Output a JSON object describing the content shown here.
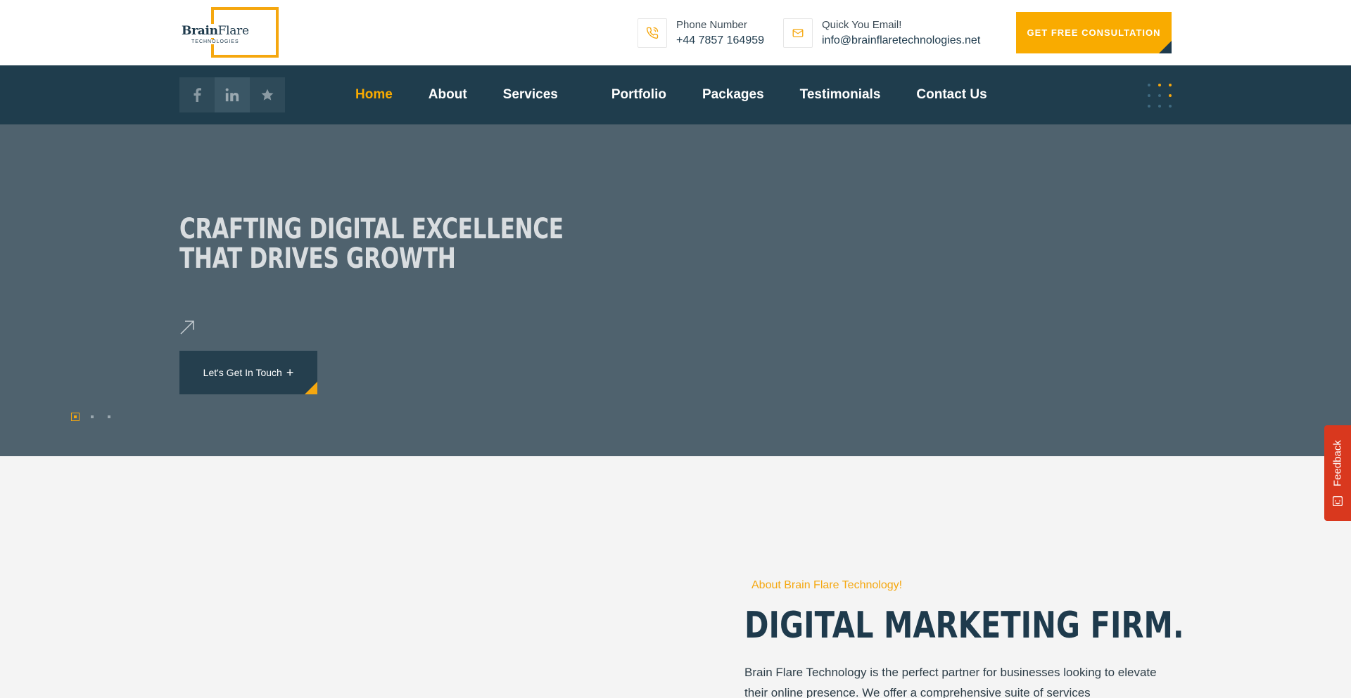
{
  "header": {
    "logo": {
      "brand_bold": "Brain",
      "brand_light": "Flare",
      "sub": "TECHNOLOGIES"
    },
    "phone": {
      "label": "Phone Number",
      "value": "+44 7857 164959",
      "icon": "phone-icon"
    },
    "email": {
      "label": "Quick You Email!",
      "value": "info@brainflaretechnologies.net",
      "icon": "mail-icon"
    },
    "cta_label": "GET FREE CONSULTATION"
  },
  "nav": {
    "social": [
      {
        "icon": "facebook-icon"
      },
      {
        "icon": "linkedin-icon"
      },
      {
        "icon": "star-icon"
      }
    ],
    "items": [
      {
        "label": "Home"
      },
      {
        "label": "About"
      },
      {
        "label": "Services"
      },
      {
        "label": "Portfolio"
      },
      {
        "label": "Packages"
      },
      {
        "label": "Testimonials"
      },
      {
        "label": "Contact Us"
      }
    ],
    "active": "Home",
    "menu_icon": "dots-grid-icon"
  },
  "hero": {
    "title_line1": "CRAFTING DIGITAL EXCELLENCE",
    "title_line2": "THAT DRIVES GROWTH",
    "button_label": "Let's Get In Touch",
    "button_plus": "+",
    "slider_count": 3,
    "slider_active": 1
  },
  "feedback": {
    "label": "Feedback"
  },
  "about": {
    "kicker": "About Brain Flare Technology!",
    "title": "DIGITAL MARKETING FIRM.",
    "text": "Brain Flare Technology is the perfect partner for businesses looking to elevate their online presence. We offer a comprehensive suite of services"
  },
  "colors": {
    "accent": "#f9ab00",
    "navy": "#1f3d4d",
    "hero_bg": "#4f626e",
    "feedback": "#d9381e"
  }
}
